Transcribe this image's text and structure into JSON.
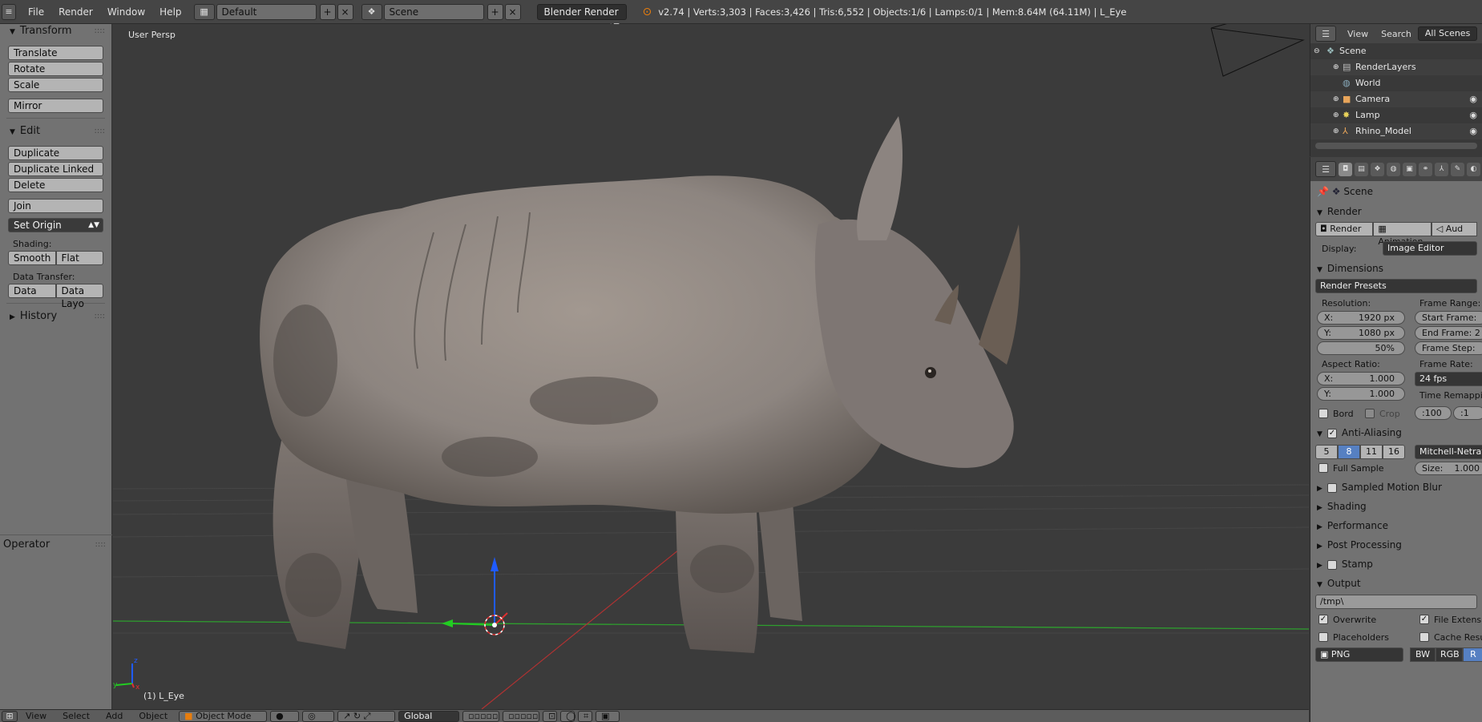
{
  "topbar": {
    "menus": [
      "File",
      "Render",
      "Window",
      "Help"
    ],
    "screen_layout": "Default",
    "scene": "Scene",
    "render_engine": "Blender Render",
    "stats": "v2.74 | Verts:3,303 | Faces:3,426 | Tris:6,552 | Objects:1/6 | Lamps:0/1 | Mem:8.64M (64.11M) | L_Eye"
  },
  "toolshelf": {
    "transform_header": "Transform",
    "translate": "Translate",
    "rotate": "Rotate",
    "scale": "Scale",
    "mirror": "Mirror",
    "edit_header": "Edit",
    "duplicate": "Duplicate",
    "duplicate_linked": "Duplicate Linked",
    "delete": "Delete",
    "join": "Join",
    "set_origin": "Set Origin",
    "shading_label": "Shading:",
    "smooth": "Smooth",
    "flat": "Flat",
    "data_transfer_label": "Data Transfer:",
    "data": "Data",
    "data_layout": "Data Layo",
    "history_header": "History",
    "operator_header": "Operator"
  },
  "viewport": {
    "view_label": "User Persp",
    "object_label": "(1) L_Eye",
    "axis_x": "x",
    "axis_y": "y",
    "axis_z": "z"
  },
  "bottombar": {
    "menus": [
      "View",
      "Select",
      "Add",
      "Object"
    ],
    "mode": "Object Mode",
    "orientation": "Global"
  },
  "outliner": {
    "view": "View",
    "search": "Search",
    "filter": "All Scenes",
    "items": [
      "Scene",
      "RenderLayers",
      "World",
      "Camera",
      "Lamp",
      "Rhino_Model"
    ]
  },
  "properties": {
    "context": "Scene",
    "render_header": "Render",
    "render_btn": "Render",
    "animation_btn": "Animation",
    "audio_btn": "Aud",
    "display_label": "Display:",
    "display_value": "Image Editor",
    "dimensions_header": "Dimensions",
    "render_presets": "Render Presets",
    "resolution_label": "Resolution:",
    "res_x": "1920 px",
    "res_y": "1080 px",
    "res_pct": "50%",
    "x_label": "X:",
    "y_label": "Y:",
    "frame_range_label": "Frame Range:",
    "start_frame": "Start Frame:",
    "end_frame": "End Frame: 2",
    "frame_step": "Frame Step:",
    "aspect_label": "Aspect Ratio:",
    "aspect_x": "1.000",
    "aspect_y": "1.000",
    "frame_rate_label": "Frame Rate:",
    "fps": "24 fps",
    "time_remap_label": "Time Remappin",
    "remap_old": ":100",
    "remap_new": ":1",
    "bord": "Bord",
    "crop": "Crop",
    "aa_header": "Anti-Aliasing",
    "aa_samples": [
      "5",
      "8",
      "11",
      "16"
    ],
    "aa_filter": "Mitchell-Netrav",
    "full_sample": "Full Sample",
    "aa_size": "Size:",
    "aa_size_value": "1.000",
    "sampled_motion_blur": "Sampled Motion Blur",
    "shading": "Shading",
    "performance": "Performance",
    "post_processing": "Post Processing",
    "stamp": "Stamp",
    "output_header": "Output",
    "output_path": "/tmp\\",
    "overwrite": "Overwrite",
    "file_extensions": "File Extensio",
    "placeholders": "Placeholders",
    "cache_result": "Cache Resul",
    "file_format": "PNG",
    "bw": "BW",
    "rgb": "RGB",
    "rgba": "R"
  },
  "colors": {
    "accent_blue": "#5680c2",
    "grid_green": "#2e9f2e",
    "grid_red": "#b03232",
    "manip_blue": "#1f5bff",
    "manip_green": "#22cc22",
    "manip_red": "#e03030"
  }
}
